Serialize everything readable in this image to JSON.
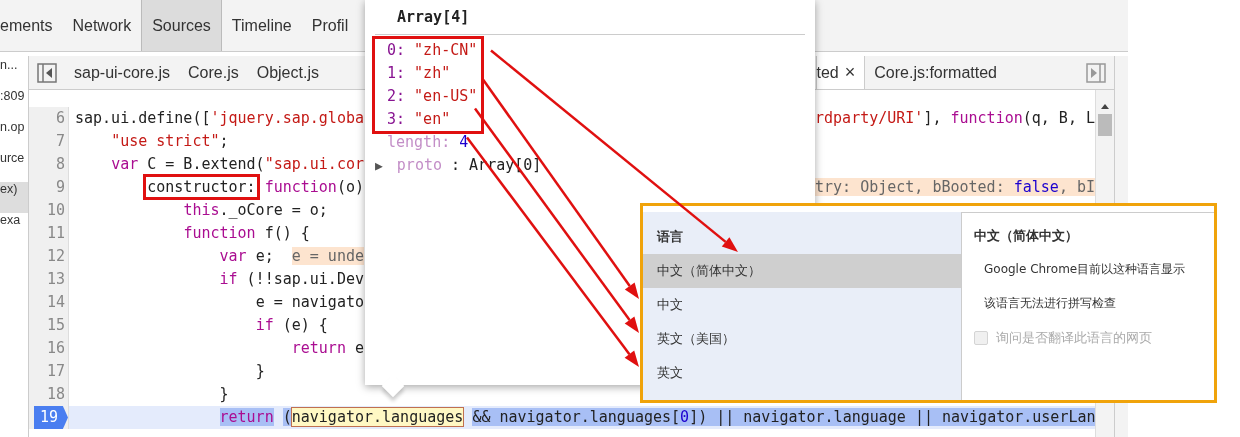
{
  "tabs": [
    {
      "label": "ements",
      "selected": false
    },
    {
      "label": "Network",
      "selected": false
    },
    {
      "label": "Sources",
      "selected": true
    },
    {
      "label": "Timeline",
      "selected": false
    },
    {
      "label": "Profil",
      "selected": false
    }
  ],
  "sidebar": {
    "items": [
      {
        "label": "n...",
        "selected": false
      },
      {
        "label": ":809",
        "selected": false
      },
      {
        "label": "n.op",
        "selected": false
      },
      {
        "label": "urce",
        "selected": false
      },
      {
        "label": "ex)",
        "selected": true
      },
      {
        "label": "exa",
        "selected": false
      }
    ]
  },
  "file_tabs": [
    {
      "label": "sap-ui-core.js",
      "active": false
    },
    {
      "label": "Core.js",
      "active": false
    },
    {
      "label": "Object.js",
      "active": false
    },
    {
      "label": "ted",
      "active": true,
      "close": "×"
    },
    {
      "label": "Core.js:formatted",
      "active": false
    }
  ],
  "code": {
    "lines": [
      {
        "number": "6",
        "current": false,
        "left": [
          {
            "kind": "plain",
            "text": "sap.ui.define(["
          },
          {
            "kind": "str",
            "text": "'jquery.sap.globa"
          }
        ],
        "right": [
          {
            "kind": "str",
            "text": "rdparty/URI'"
          },
          {
            "kind": "plain",
            "text": "], "
          },
          {
            "kind": "kw",
            "text": "function"
          },
          {
            "kind": "plain",
            "text": "(q, B, L"
          }
        ]
      },
      {
        "number": "7",
        "current": false,
        "left": [
          {
            "kind": "str",
            "text": "    \"use strict\""
          },
          {
            "kind": "plain",
            "text": ";"
          }
        ]
      },
      {
        "number": "8",
        "current": false,
        "left": [
          {
            "kind": "kw",
            "text": "    var"
          },
          {
            "kind": "plain",
            "text": " C = B.extend("
          },
          {
            "kind": "str",
            "text": "\"sap.ui.cor"
          }
        ]
      },
      {
        "number": "9",
        "current": false,
        "left": [
          {
            "kind": "boxed",
            "text": "        constructor:"
          },
          {
            "kind": "kw",
            "text": " function"
          },
          {
            "kind": "plain",
            "text": "(o)"
          }
        ],
        "right": [
          {
            "kind": "value",
            "text": "try: Object, bBooted: "
          },
          {
            "kind": "value-num",
            "text": "false"
          },
          {
            "kind": "value",
            "text": ", bI"
          }
        ]
      },
      {
        "number": "10",
        "current": false,
        "left": [
          {
            "kind": "kw",
            "text": "            this"
          },
          {
            "kind": "plain",
            "text": "._oCore = o;"
          }
        ]
      },
      {
        "number": "11",
        "current": false,
        "left": [
          {
            "kind": "kw",
            "text": "            function"
          },
          {
            "kind": "plain",
            "text": " f() {"
          }
        ]
      },
      {
        "number": "12",
        "current": false,
        "left": [
          {
            "kind": "kw",
            "text": "                var"
          },
          {
            "kind": "plain",
            "text": " e;  "
          },
          {
            "kind": "value",
            "text": "e = unde"
          }
        ]
      },
      {
        "number": "13",
        "current": false,
        "left": [
          {
            "kind": "kw",
            "text": "                if"
          },
          {
            "kind": "plain",
            "text": " (!!sap.ui.Dev"
          }
        ]
      },
      {
        "number": "14",
        "current": false,
        "left": [
          {
            "kind": "plain",
            "text": "                    e = navigato"
          }
        ]
      },
      {
        "number": "15",
        "current": false,
        "left": [
          {
            "kind": "kw",
            "text": "                    if"
          },
          {
            "kind": "plain",
            "text": " (e) {"
          }
        ]
      },
      {
        "number": "16",
        "current": false,
        "left": [
          {
            "kind": "kw",
            "text": "                        return"
          },
          {
            "kind": "plain",
            "text": " e"
          }
        ]
      },
      {
        "number": "17",
        "current": false,
        "left": [
          {
            "kind": "plain",
            "text": "                    }"
          }
        ]
      },
      {
        "number": "18",
        "current": false,
        "left": [
          {
            "kind": "plain",
            "text": "                }"
          }
        ]
      },
      {
        "number": "19",
        "current": true,
        "left": [
          {
            "kind": "kw",
            "text": "                return"
          },
          {
            "kind": "plain",
            "text": " ("
          },
          {
            "kind": "match",
            "text": "navigator.languages"
          },
          {
            "kind": "plain",
            "text": " && navigator.languages["
          },
          {
            "kind": "num",
            "text": "0"
          },
          {
            "kind": "plain",
            "text": "]) || navigator.language || navigator.userLan"
          }
        ]
      }
    ]
  },
  "popover": {
    "title": "Array[4]",
    "highlighted": true,
    "items": [
      {
        "index": "0:",
        "value": "\"zh-CN\""
      },
      {
        "index": "1:",
        "value": "\"zh\""
      },
      {
        "index": "2:",
        "value": "\"en-US\""
      },
      {
        "index": "3:",
        "value": "\"en\""
      }
    ],
    "length": {
      "key": "length:",
      "value": "4"
    },
    "proto": {
      "toggle": "▶",
      "key": "proto",
      "value": ": Array[0]"
    }
  },
  "language_panel": {
    "heading": "语言",
    "languages": [
      {
        "label": "中文（简体中文）",
        "selected": true
      },
      {
        "label": "中文",
        "selected": false
      },
      {
        "label": "英文（美国）",
        "selected": false
      },
      {
        "label": "英文",
        "selected": false
      }
    ],
    "detail": {
      "title": "中文（简体中文）",
      "notes": [
        "Google Chrome目前以这种语言显示",
        "该语言无法进行拼写检查"
      ],
      "option": {
        "label": "询问是否翻译此语言的网页",
        "checked": false,
        "disabled": true
      }
    }
  }
}
